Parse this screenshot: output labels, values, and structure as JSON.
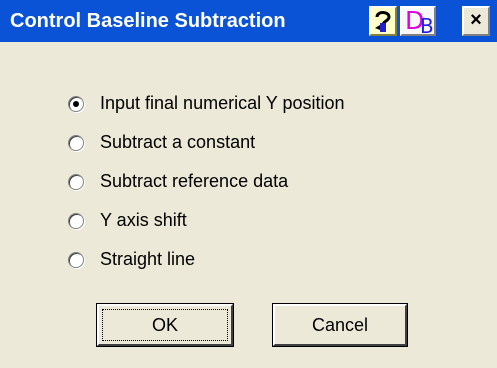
{
  "window": {
    "title": "Control Baseline Subtraction",
    "titlebar_color": "#0a52d6",
    "help_icon": "help-pointer-icon",
    "db_button": {
      "d": "D",
      "b": "B"
    },
    "close_label": "×"
  },
  "options": [
    {
      "label": "Input final numerical Y position",
      "selected": true
    },
    {
      "label": "Subtract a constant",
      "selected": false
    },
    {
      "label": "Subtract reference data",
      "selected": false
    },
    {
      "label": "Y axis shift",
      "selected": false
    },
    {
      "label": "Straight line",
      "selected": false
    }
  ],
  "buttons": {
    "ok": "OK",
    "cancel": "Cancel"
  }
}
